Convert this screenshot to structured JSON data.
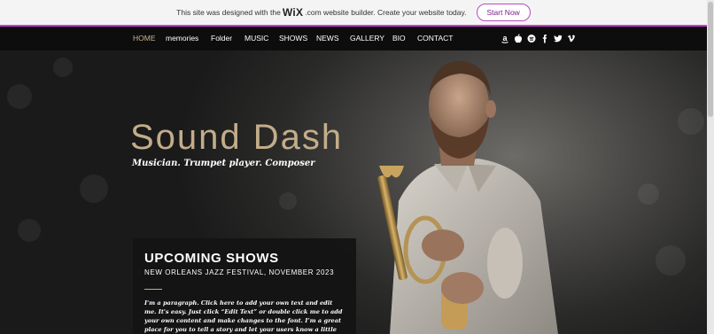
{
  "banner": {
    "text_before": "This site was designed with the",
    "brand": "WiX",
    "text_after": ".com website builder. Create your website today.",
    "cta_label": "Start Now",
    "accent_color": "#d03bd6"
  },
  "nav": {
    "items": [
      {
        "label": "HOME",
        "active": true
      },
      {
        "label": "memories"
      },
      {
        "label": "Folder"
      },
      {
        "label": "MUSIC"
      },
      {
        "label": "SHOWS"
      },
      {
        "label": "NEWS"
      },
      {
        "label": "GALLERY"
      },
      {
        "label": "BIO"
      },
      {
        "label": "CONTACT"
      }
    ],
    "social_icons": [
      "amazon-icon",
      "apple-icon",
      "spotify-icon",
      "facebook-icon",
      "twitter-icon",
      "vimeo-icon"
    ]
  },
  "hero": {
    "title": "Sound Dash",
    "subtitle": "Musician. Trumpet player. Composer"
  },
  "shows": {
    "title": "UPCOMING SHOWS",
    "event": "NEW ORLEANS JAZZ FESTIVAL, NOVEMBER 2023",
    "body": "I'm a paragraph. Click here to add your own text and edit me. It's easy. Just click “Edit Text” or double click me to add your own content and make changes to the font. I’m a great place for you to tell a story and let your users know a little more about you."
  },
  "colors": {
    "accent_gold": "#c3ad89",
    "nav_background": "#0d0d0d"
  }
}
